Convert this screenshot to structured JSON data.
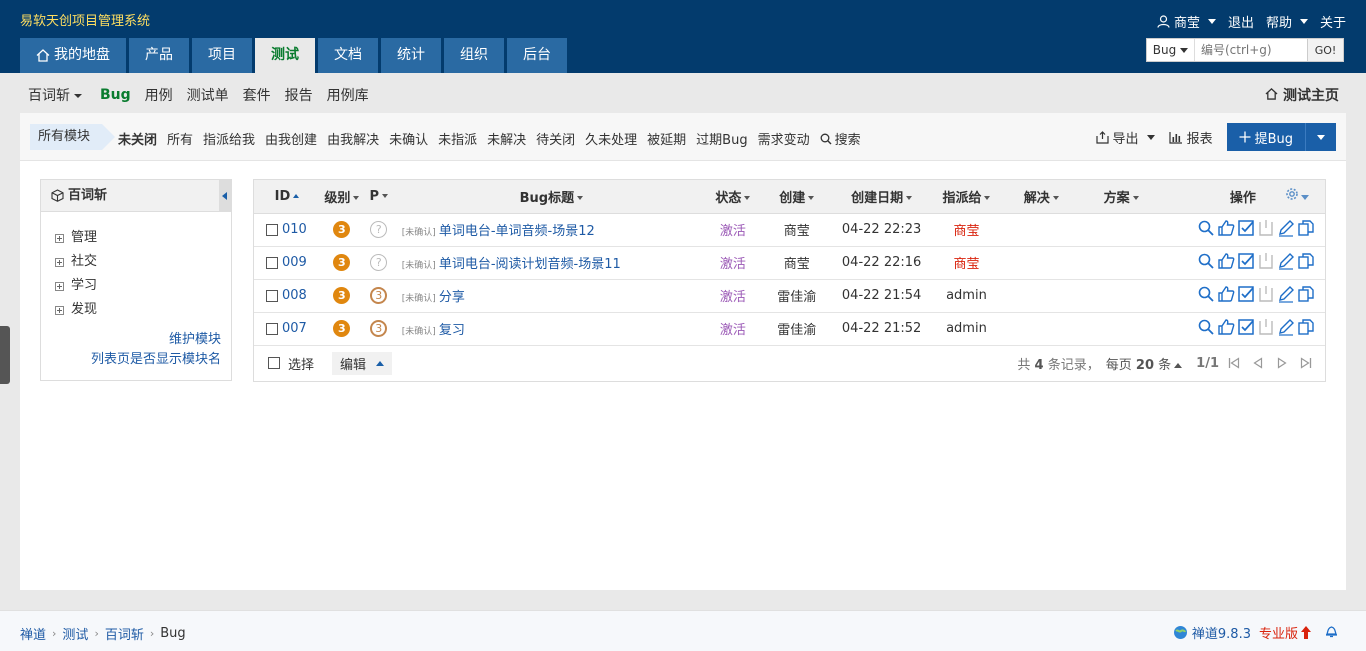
{
  "brand": "易软天创项目管理系统",
  "topbar": {
    "user": "商莹",
    "logout": "退出",
    "help": "帮助",
    "about": "关于"
  },
  "nav": [
    "我的地盘",
    "产品",
    "项目",
    "测试",
    "文档",
    "统计",
    "组织",
    "后台"
  ],
  "search": {
    "type": "Bug",
    "placeholder": "编号(ctrl+g)",
    "go": "GO!"
  },
  "subnav": {
    "product": "百词斩",
    "items": [
      "Bug",
      "用例",
      "测试单",
      "套件",
      "报告",
      "用例库"
    ],
    "home": "测试主页"
  },
  "featurebar": {
    "module_tag": "所有模块",
    "filters": [
      "未关闭",
      "所有",
      "指派给我",
      "由我创建",
      "由我解决",
      "未确认",
      "未指派",
      "未解决",
      "待关闭",
      "久未处理",
      "被延期",
      "过期Bug",
      "需求变动",
      "搜索"
    ],
    "export": "导出",
    "report": "报表",
    "add": "提Bug"
  },
  "side": {
    "title": "百词斩",
    "modules": [
      "管理",
      "社交",
      "学习",
      "发现"
    ],
    "maintain": "维护模块",
    "show_module": "列表页是否显示模块名"
  },
  "table": {
    "headers": {
      "id": "ID",
      "severity": "级别",
      "pri": "P",
      "title": "Bug标题",
      "status": "状态",
      "creator": "创建",
      "created": "创建日期",
      "assigned": "指派给",
      "resolver": "解决",
      "resolution": "方案",
      "actions": "操作"
    },
    "rows": [
      {
        "id": "010",
        "severity": "3",
        "pri": "?",
        "tag": "[未确认]",
        "title": "单词电台-单词音频-场景12",
        "status": "激活",
        "creator": "商莹",
        "created": "04-22 22:23",
        "assigned": "商莹",
        "resolver": "",
        "resolution": ""
      },
      {
        "id": "009",
        "severity": "3",
        "pri": "?",
        "tag": "[未确认]",
        "title": "单词电台-阅读计划音频-场景11",
        "status": "激活",
        "creator": "商莹",
        "created": "04-22 22:16",
        "assigned": "商莹",
        "resolver": "",
        "resolution": ""
      },
      {
        "id": "008",
        "severity": "3",
        "pri": "3",
        "tag": "[未确认]",
        "title": "分享",
        "status": "激活",
        "creator": "雷佳渝",
        "created": "04-22 21:54",
        "assigned": "admin",
        "resolver": "",
        "resolution": ""
      },
      {
        "id": "007",
        "severity": "3",
        "pri": "3",
        "tag": "[未确认]",
        "title": "复习",
        "status": "激活",
        "creator": "雷佳渝",
        "created": "04-22 21:52",
        "assigned": "admin",
        "resolver": "",
        "resolution": ""
      }
    ],
    "footer": {
      "select": "选择",
      "edit": "编辑",
      "total_prefix": "共",
      "total": "4",
      "total_suffix": "条记录，",
      "per_page_prefix": "每页",
      "per_page": "20",
      "per_page_suffix": "条",
      "page": "1/1"
    }
  },
  "footer": {
    "crumbs": [
      "禅道",
      "测试",
      "百词斩",
      "Bug"
    ],
    "version": "禅道9.8.3",
    "edition": "专业版"
  },
  "colors": {
    "header_bg": "#033b6d",
    "nav_tab": "#2a6aa3",
    "accent": "#1a5fa8",
    "active_green": "#0a7c2f",
    "brand_yellow": "#ffde60"
  }
}
